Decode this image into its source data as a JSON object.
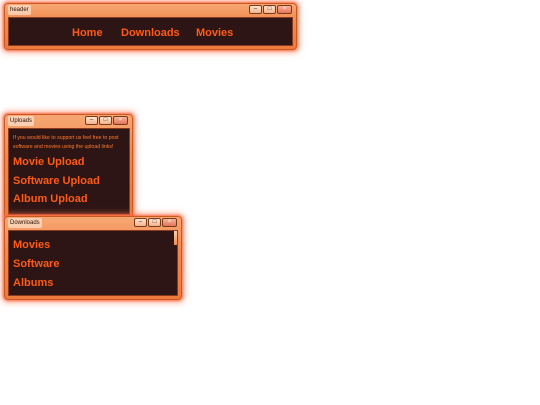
{
  "windows": {
    "header": {
      "title": "header",
      "nav": [
        "Home",
        "Downloads",
        "Movies"
      ]
    },
    "uploads": {
      "title": "Uploads",
      "message": "If you would like to support us feel free to post software and movies using the upload links!",
      "links": [
        "Movie Upload",
        "Software Upload",
        "Album Upload"
      ]
    },
    "downloads": {
      "title": "Downloads",
      "links": [
        "Movies",
        "Software",
        "Albums"
      ]
    }
  },
  "controls": {
    "minimize": "–",
    "maximize": "□",
    "close": "×"
  },
  "icons": [
    "minimize-icon",
    "maximize-icon",
    "close-icon"
  ],
  "colors": {
    "frame": "#f08a4c",
    "client_bg": "#2e1515",
    "link": "#ff5a14",
    "glow": "#ff7850"
  }
}
